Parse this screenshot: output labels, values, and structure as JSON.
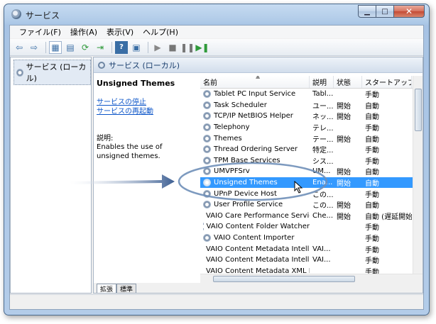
{
  "window": {
    "title": "サービス"
  },
  "menu": [
    "ファイル(F)",
    "操作(A)",
    "表示(V)",
    "ヘルプ(H)"
  ],
  "toolbar": {
    "icons": [
      "back-icon",
      "forward-icon",
      "console-tree-icon",
      "properties-icon",
      "refresh-icon",
      "export-icon",
      "help-icon",
      "view-icon",
      "start-icon",
      "stop-icon",
      "pause-icon",
      "restart-icon"
    ]
  },
  "tree": {
    "root_label": "サービス (ローカル)"
  },
  "pane": {
    "header": "サービス (ローカル)",
    "selected_name": "Unsigned Themes",
    "link_stop": "サービスの停止",
    "link_restart": "サービスの再起動",
    "desc_label": "説明:",
    "desc_text": "Enables the use of unsigned themes."
  },
  "columns": [
    "名前",
    "説明",
    "状態",
    "スタートアップの"
  ],
  "rows": [
    {
      "name": "Tablet PC Input Service",
      "desc": "Tabl...",
      "status": "",
      "startup": "手動"
    },
    {
      "name": "Task Scheduler",
      "desc": "ユー...",
      "status": "開始",
      "startup": "自動"
    },
    {
      "name": "TCP/IP NetBIOS Helper",
      "desc": "ネッ...",
      "status": "開始",
      "startup": "自動"
    },
    {
      "name": "Telephony",
      "desc": "テレ...",
      "status": "",
      "startup": "手動"
    },
    {
      "name": "Themes",
      "desc": "テー...",
      "status": "開始",
      "startup": "自動"
    },
    {
      "name": "Thread Ordering Server",
      "desc": "特定...",
      "status": "",
      "startup": "手動"
    },
    {
      "name": "TPM Base Services",
      "desc": "シス...",
      "status": "",
      "startup": "手動"
    },
    {
      "name": "UMVPFSrv",
      "desc": "UM...",
      "status": "開始",
      "startup": "自動"
    },
    {
      "name": "Unsigned Themes",
      "desc": "Ena...",
      "status": "開始",
      "startup": "自動",
      "selected": true
    },
    {
      "name": "UPnP Device Host",
      "desc": "この...",
      "status": "",
      "startup": "手動"
    },
    {
      "name": "User Profile Service",
      "desc": "この...",
      "status": "開始",
      "startup": "自動"
    },
    {
      "name": "VAIO Care Performance Service",
      "desc": "Che...",
      "status": "開始",
      "startup": "自動 (遅延開始)"
    },
    {
      "name": "VAIO Content Folder Watcher",
      "desc": "",
      "status": "",
      "startup": "手動"
    },
    {
      "name": "VAIO Content Importer",
      "desc": "",
      "status": "",
      "startup": "手動"
    },
    {
      "name": "VAIO Content Metadata Intelli...",
      "desc": "VAI...",
      "status": "",
      "startup": "手動"
    },
    {
      "name": "VAIO Content Metadata Intelli...",
      "desc": "VAI...",
      "status": "",
      "startup": "手動"
    },
    {
      "name": "VAIO Content Metadata XML I...",
      "desc": "",
      "status": "",
      "startup": "手動"
    }
  ],
  "tabs": [
    "拡張",
    "標準"
  ],
  "colors": {
    "selection": "#3399ff",
    "link": "#0b54c8",
    "arrow": "#3d5f93"
  }
}
